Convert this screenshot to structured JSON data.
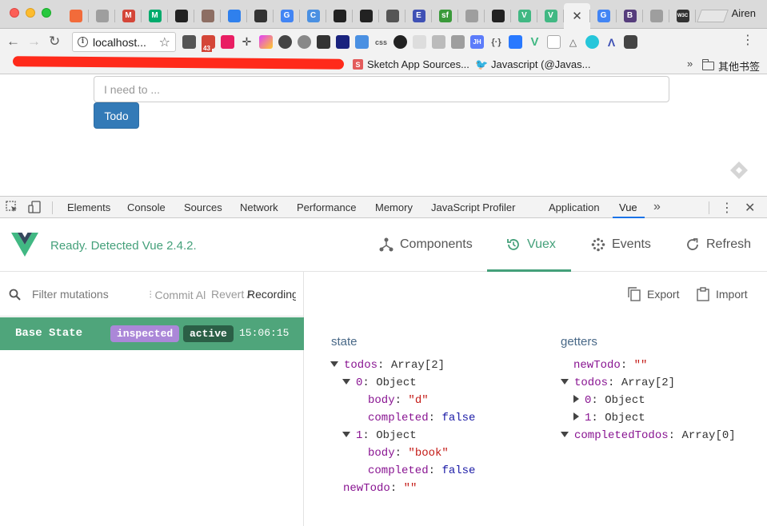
{
  "browser": {
    "profile_name": "Airen",
    "url": "localhost...",
    "tabs": [
      {
        "icon": "gear-icon",
        "color": "#f26b3a",
        "label": ""
      },
      {
        "icon": "page-icon",
        "color": "#9e9e9e",
        "label": ""
      },
      {
        "icon": "gmail-icon",
        "color": "#d44638",
        "label": "M"
      },
      {
        "icon": "medium-icon",
        "color": "#00ab6c",
        "label": "M"
      },
      {
        "icon": "github-icon",
        "color": "#222222",
        "label": ""
      },
      {
        "icon": "avatar-icon",
        "color": "#8d6e63",
        "label": ""
      },
      {
        "icon": "arc-icon",
        "color": "#2f80ed",
        "label": ""
      },
      {
        "icon": "cloud-icon",
        "color": "#333333",
        "label": ""
      },
      {
        "icon": "google-icon",
        "color": "#4285f4",
        "label": "G"
      },
      {
        "icon": "c-icon",
        "color": "#4a90e2",
        "label": "C"
      },
      {
        "icon": "github-icon",
        "color": "#222222",
        "label": ""
      },
      {
        "icon": "github-icon",
        "color": "#222222",
        "label": ""
      },
      {
        "icon": "square-icon",
        "color": "#555555",
        "label": ""
      },
      {
        "icon": "e-icon",
        "color": "#3f51b5",
        "label": "E"
      },
      {
        "icon": "sf-icon",
        "color": "#3a9a3a",
        "label": "sf"
      },
      {
        "icon": "page-icon",
        "color": "#9e9e9e",
        "label": ""
      },
      {
        "icon": "github-icon",
        "color": "#222222",
        "label": ""
      },
      {
        "icon": "vue-icon",
        "color": "#41b883",
        "label": "V"
      },
      {
        "icon": "vue-icon",
        "color": "#41b883",
        "label": "V"
      },
      {
        "icon": "close-icon",
        "color": "#444444",
        "label": "✕",
        "active": true
      },
      {
        "icon": "google-icon",
        "color": "#4285f4",
        "label": "G"
      },
      {
        "icon": "b-icon",
        "color": "#563d7c",
        "label": "B"
      },
      {
        "icon": "page-icon",
        "color": "#9e9e9e",
        "label": ""
      },
      {
        "icon": "w3c-icon",
        "color": "#333333",
        "label": "W3C"
      }
    ],
    "bookmarks": [
      {
        "label": "Sketch App Sources...",
        "icon": "sketch-icon",
        "color": "#e35b5b"
      },
      {
        "label": "Javascript (@Javas...",
        "icon": "twitter-icon",
        "color": "#1da1f2"
      }
    ],
    "other_bookmarks": "其他书签",
    "bookmarks_more": "»",
    "extension_badge": "43"
  },
  "page": {
    "todo_placeholder": "I need to ...",
    "todo_value": "",
    "todo_button": "Todo"
  },
  "devtools": {
    "tabs": [
      "Elements",
      "Console",
      "Sources",
      "Network",
      "Performance",
      "Memory",
      "JavaScript Profiler",
      "Application",
      "Vue"
    ],
    "active_tab": "Vue",
    "overflow": "»"
  },
  "vue_devtools": {
    "status": "Ready. Detected Vue 2.4.2.",
    "nav": [
      {
        "label": "Components",
        "icon": "components-icon"
      },
      {
        "label": "Vuex",
        "icon": "history-icon",
        "active": true
      },
      {
        "label": "Events",
        "icon": "events-icon"
      },
      {
        "label": "Refresh",
        "icon": "refresh-icon"
      }
    ],
    "filter_placeholder": "Filter mutations",
    "commit_all": "Commit All",
    "revert_all": "Revert All",
    "recording": "Recording",
    "export": "Export",
    "import": "Import",
    "base_state": {
      "label": "Base State",
      "badge_inspected": "inspected",
      "badge_active": "active",
      "time": "15:06:15"
    },
    "state_title": "state",
    "getters_title": "getters",
    "state": {
      "todos_key": "todos",
      "todos_val": "Array[2]",
      "item0_key": "0",
      "item0_val": "Object",
      "item0_body_key": "body",
      "item0_body_val": "\"d\"",
      "item0_completed_key": "completed",
      "item0_completed_val": "false",
      "item1_key": "1",
      "item1_val": "Object",
      "item1_body_key": "body",
      "item1_body_val": "\"book\"",
      "item1_completed_key": "completed",
      "item1_completed_val": "false",
      "newTodo_key": "newTodo",
      "newTodo_val": "\"\""
    },
    "getters": {
      "newTodo_key": "newTodo",
      "newTodo_val": "\"\"",
      "todos_key": "todos",
      "todos_val": "Array[2]",
      "item0_key": "0",
      "item0_val": "Object",
      "item1_key": "1",
      "item1_val": "Object",
      "completed_key": "completedTodos",
      "completed_val": "Array[0]"
    }
  }
}
